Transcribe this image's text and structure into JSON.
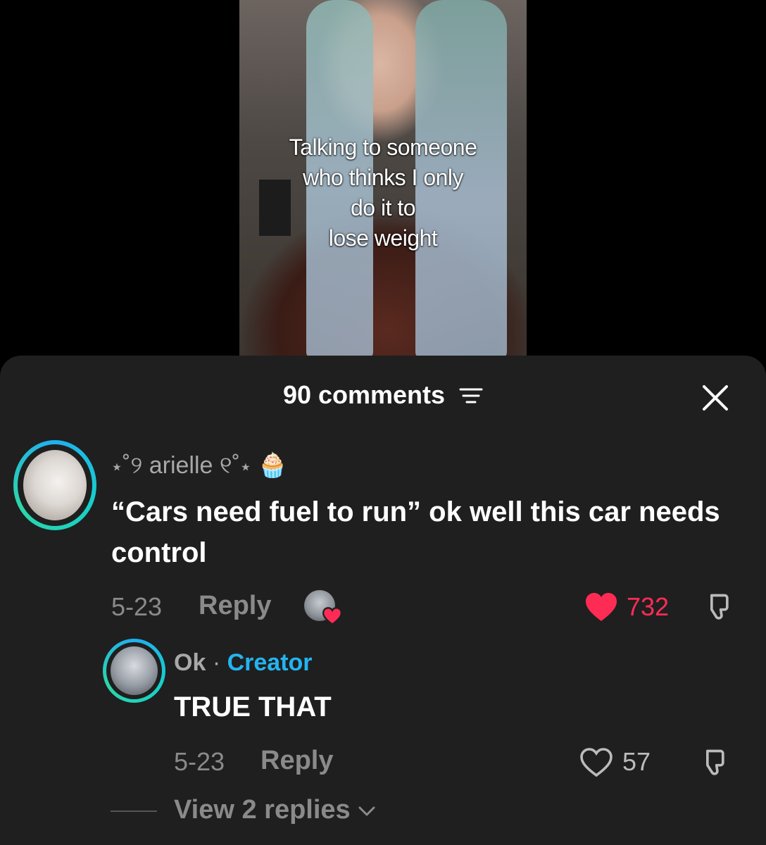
{
  "video": {
    "caption": "Talking to someone\nwho thinks I only\ndo it to\nlose weight"
  },
  "comments_header": {
    "count_label": "90 comments"
  },
  "comments": [
    {
      "username": "⋆˚୨ arielle ୧˚⋆",
      "emoji": "🧁",
      "text": "“Cars need fuel to run” ok well this car needs control",
      "date": "5-23",
      "reply_label": "Reply",
      "likes": "732",
      "liked": true
    }
  ],
  "reply": {
    "username": "Ok",
    "separator": "·",
    "badge": "Creator",
    "text": "TRUE THAT",
    "date": "5-23",
    "reply_label": "Reply",
    "likes": "57",
    "liked": false
  },
  "view_replies": {
    "label": "View 2 replies"
  },
  "colors": {
    "sheet_bg": "#1f1f1f",
    "like_red": "#fe2c55",
    "creator_blue": "#23b4f0"
  }
}
